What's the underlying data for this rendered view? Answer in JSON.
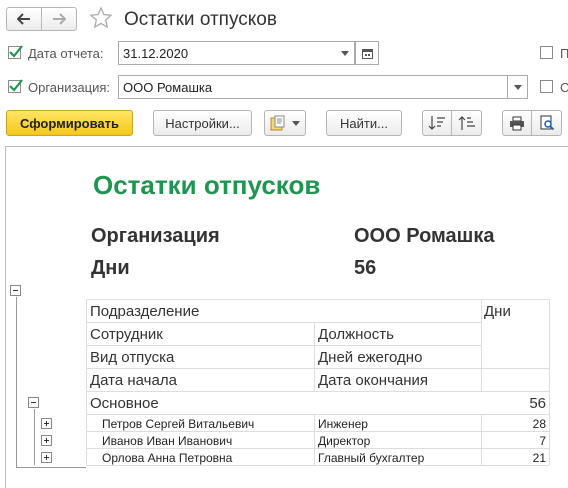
{
  "header": {
    "title": "Остатки отпусков"
  },
  "form": {
    "date_label": "Дата отчета:",
    "date_value": "31.12.2020",
    "org_label": "Организация:",
    "org_value": "ООО Ромашка"
  },
  "toolbar": {
    "generate_label": "Сформировать",
    "settings_label": "Настройки...",
    "find_label": "Найти..."
  },
  "report": {
    "title": "Остатки отпусков",
    "org_caption": "Организация",
    "org_value": "ООО Ромашка",
    "days_caption": "Дни",
    "days_value": "56",
    "headers": {
      "department": "Подразделение",
      "days": "Дни",
      "employee": "Сотрудник",
      "position": "Должность",
      "leave_type": "Вид отпуска",
      "days_per_year": "Дней ежегодно",
      "start_date": "Дата начала",
      "end_date": "Дата окончания"
    },
    "group": {
      "name": "Основное",
      "total": "56"
    },
    "rows": [
      {
        "name": "Петров Сергей Витальевич",
        "position": "Инженер",
        "days": "28"
      },
      {
        "name": "Иванов Иван Иванович",
        "position": "Директор",
        "days": "7"
      },
      {
        "name": "Орлова Анна Петровна",
        "position": "Главный бухгалтер",
        "days": "21"
      }
    ]
  },
  "colors": {
    "accent_green": "#1e9650",
    "primary_button": "#f3c81a",
    "checkbox_green": "#1e9650"
  }
}
